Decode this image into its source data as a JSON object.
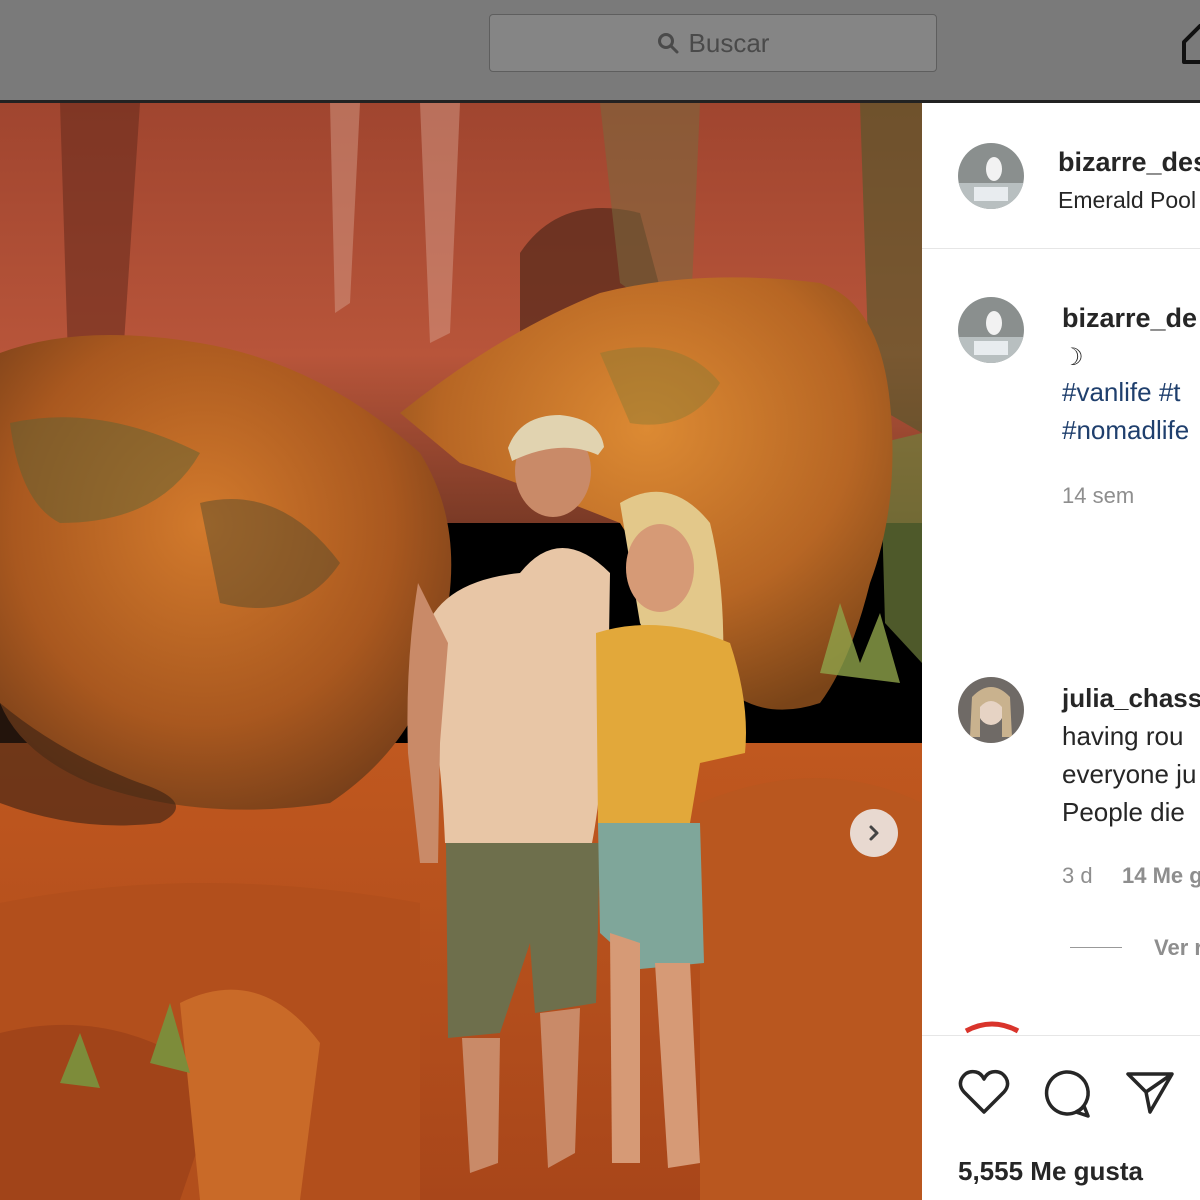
{
  "topbar": {
    "search_placeholder": "Buscar",
    "search_icon": "search-icon",
    "home_icon": "home-icon"
  },
  "post": {
    "author": "bizarre_des",
    "location": "Emerald Pool",
    "caption": {
      "author": "bizarre_de",
      "symbol": "☽",
      "hashtags_line1": "#vanlife #t",
      "hashtags_line2": "#nomadlife",
      "time": "14 sem"
    },
    "comment": {
      "author": "julia_chass",
      "lines": [
        "having rou",
        "everyone ju",
        "People die"
      ],
      "time": "3 d",
      "likes": "14 Me g",
      "view_replies": "Ver r"
    },
    "likes_count": "5,555 Me gusta",
    "icons": [
      "heart-icon",
      "comment-icon",
      "share-icon",
      "next-arrow-icon"
    ]
  },
  "colors": {
    "hashtag": "#1f3f6d",
    "text": "#262626",
    "muted": "#8e8e8e",
    "topbar_dim": "#7a7a7a"
  }
}
